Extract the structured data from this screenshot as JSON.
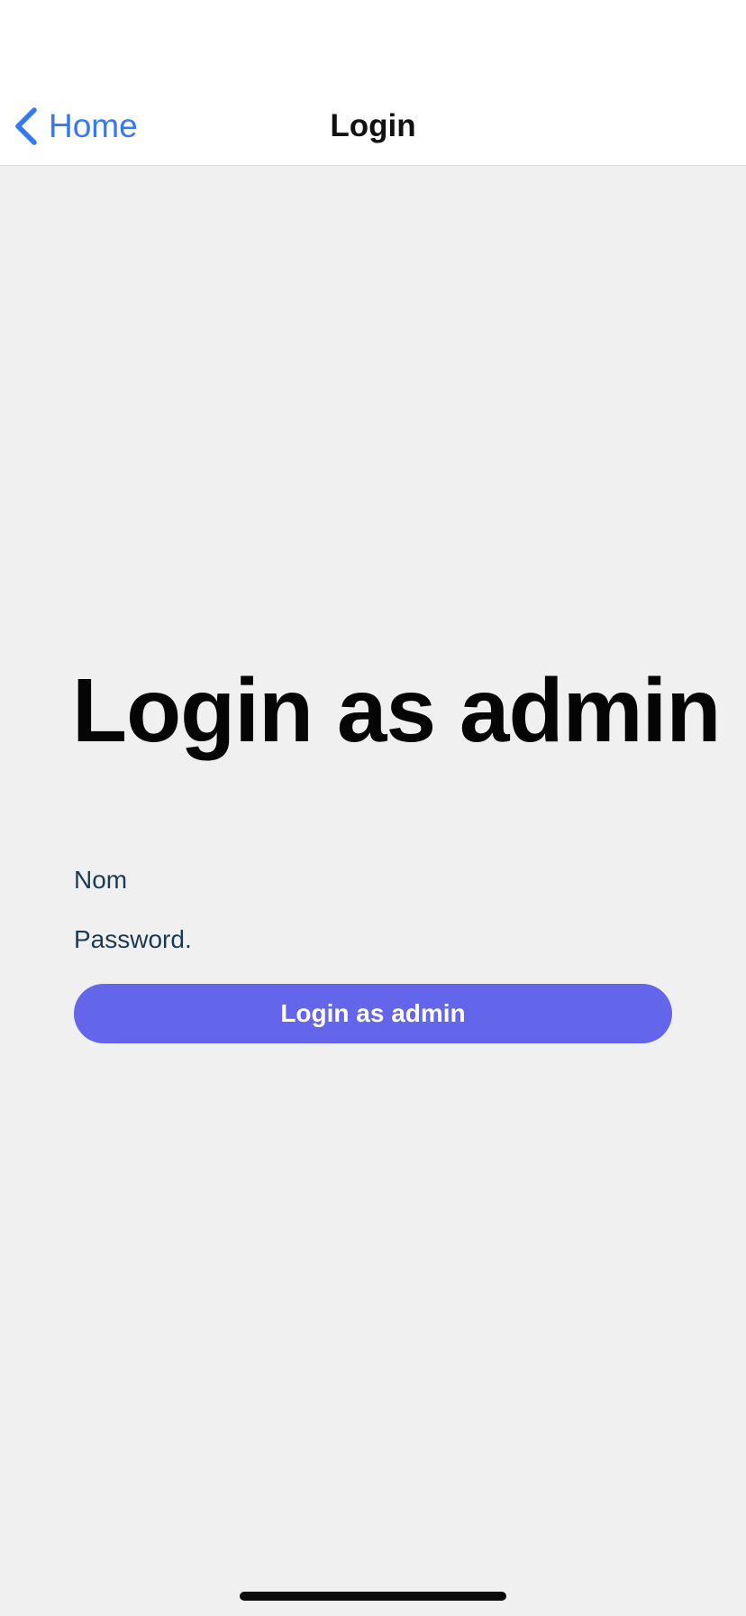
{
  "navbar": {
    "back_label": "Home",
    "title": "Login"
  },
  "main": {
    "headline": "Login as admin",
    "name_placeholder": "Nom",
    "password_placeholder": "Password.",
    "submit_label": "Login as admin"
  },
  "icons": {
    "back": "chevron-left-icon"
  },
  "colors": {
    "accent": "#3478f6",
    "button": "#6366ea",
    "background": "#f0f0f1",
    "field_text": "#1c3a52"
  }
}
